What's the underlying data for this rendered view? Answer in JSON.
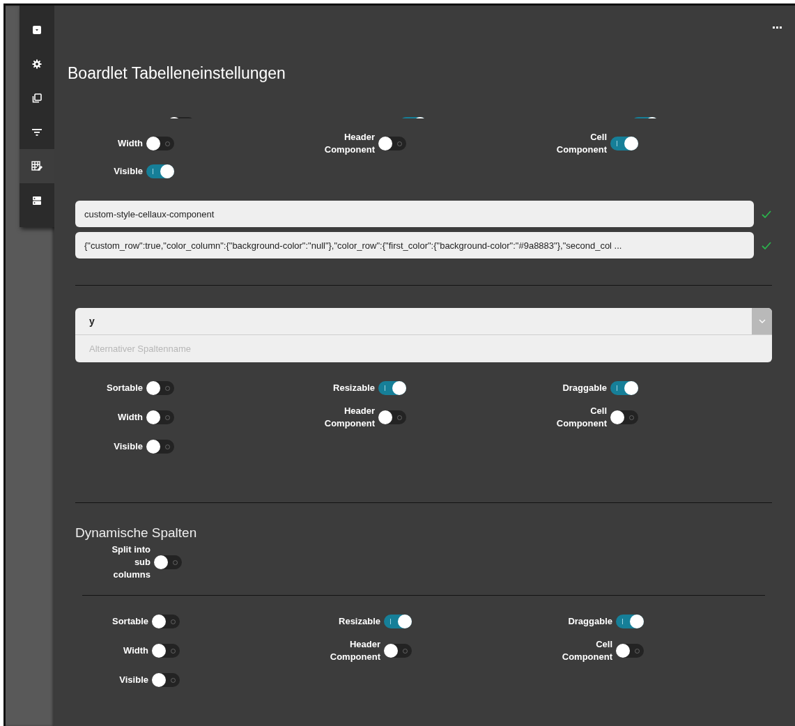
{
  "sidebar": {
    "items": [
      {
        "selected": false
      },
      {
        "selected": false
      },
      {
        "selected": false
      },
      {
        "selected": false
      },
      {
        "selected": true
      },
      {
        "selected": false
      }
    ]
  },
  "title": "Boardlet Tabelleneinstellungen",
  "column_1": {
    "clipped_toggles": [
      {
        "on": false
      },
      {
        "on": true
      },
      {
        "on": true
      }
    ],
    "toggles": [
      {
        "label": "Width",
        "on": false
      },
      {
        "label": "Header Component",
        "on": false
      },
      {
        "label": "Cell Component",
        "on": true
      },
      {
        "label": "Visible",
        "on": true
      }
    ],
    "fields": [
      {
        "value": "custom-style-cellaux-component",
        "valid": true
      },
      {
        "value": "{\"custom_row\":true,\"color_column\":{\"background-color\":\"null\"},\"color_row\":{\"first_color\":{\"background-color\":\"#9a8883\"},\"second_col ...",
        "valid": true
      }
    ]
  },
  "column_2": {
    "select": {
      "value": "y"
    },
    "name_field": {
      "placeholder": "Alternativer Spaltenname"
    },
    "toggles": [
      {
        "label": "Sortable",
        "on": false
      },
      {
        "label": "Resizable",
        "on": true
      },
      {
        "label": "Draggable",
        "on": true
      },
      {
        "label": "Width",
        "on": false
      },
      {
        "label": "Header Component",
        "on": false
      },
      {
        "label": "Cell Component",
        "on": false
      },
      {
        "label": "Visible",
        "on": false
      }
    ]
  },
  "dynamic": {
    "heading": "Dynamische Spalten",
    "split": {
      "label": "Split into sub columns",
      "on": false
    },
    "toggles": [
      {
        "label": "Sortable",
        "on": false
      },
      {
        "label": "Resizable",
        "on": true
      },
      {
        "label": "Draggable",
        "on": true
      },
      {
        "label": "Width",
        "on": false
      },
      {
        "label": "Header Component",
        "on": false
      },
      {
        "label": "Cell Component",
        "on": false
      },
      {
        "label": "Visible",
        "on": false
      }
    ]
  }
}
